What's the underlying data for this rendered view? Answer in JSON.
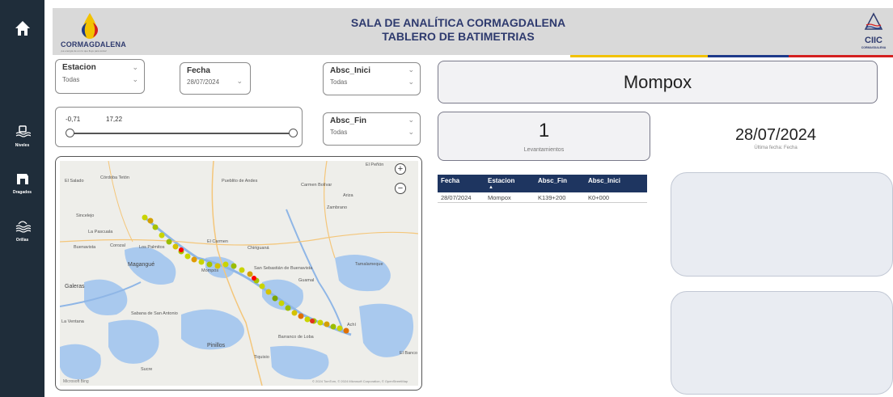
{
  "header": {
    "title_line1": "SALA DE ANALÍTICA CORMAGDALENA",
    "title_line2": "TABLERO DE BATIMETRIAS",
    "logo_left_text": "CORMAGDALENA",
    "logo_left_tagline": "¡La energía de un río que fluye para todos!",
    "logo_right_text": "CIIC",
    "logo_right_sub": "CORMAGDALENA"
  },
  "sidebar": {
    "items": [
      {
        "label": "",
        "icon": "home-icon"
      },
      {
        "label": "Niveles",
        "icon": "gauge-icon"
      },
      {
        "label": "Dragados",
        "icon": "dredge-icon"
      },
      {
        "label": "Orillas",
        "icon": "waves-icon"
      }
    ]
  },
  "filters": {
    "estacion": {
      "title": "Estacion",
      "value": "Todas"
    },
    "fecha": {
      "title": "Fecha",
      "value": "28/07/2024"
    },
    "absc_inici": {
      "title": "Absc_Inici",
      "value": "Todas"
    },
    "absc_fin": {
      "title": "Absc_Fin",
      "value": "Todas"
    },
    "range": {
      "min_label": "-0,71",
      "max_label": "17,22"
    }
  },
  "station_card": {
    "value": "Mompox"
  },
  "count_card": {
    "value": "1",
    "label": "Levantamientos"
  },
  "date_card": {
    "value": "28/07/2024",
    "label": "Última fecha: Fecha"
  },
  "table": {
    "headers": [
      "Fecha",
      "Estacion",
      "Absc_Fin",
      "Absc_Inici"
    ],
    "rows": [
      [
        "28/07/2024",
        "Mompox",
        "K139+200",
        "K0+000"
      ]
    ]
  },
  "map": {
    "labels": [
      "El Salado",
      "Córdoba Tetón",
      "Pueblito de Andes",
      "Carmen Bolívar",
      "Zambrano",
      "Ariza",
      "Sincelejo",
      "La Pascuala",
      "Corozal",
      "Los Palmitos",
      "El Carmen",
      "Chiriguaná",
      "Tamalameque",
      "Magangué",
      "Mompós",
      "Galeras",
      "San Sebastián de Buenavista",
      "Guamal",
      "Sucre",
      "Pinillos",
      "Tiquisio",
      "Barranco de Loba",
      "El Banco",
      "Achí",
      "La Ventana",
      "Sabana de San Antonio",
      "Buenavista",
      "El Peñón"
    ],
    "attribution": "© 2024 TomTom, © 2024 Microsoft Corporation, © OpenStreetMap",
    "logo": "Microsoft Bing"
  },
  "colors": {
    "sidebar": "#1f2d3a",
    "header": "#d9d9d9",
    "title": "#2e3a6e",
    "table_header": "#1e3560",
    "stripe_yellow": "#f2c200",
    "stripe_blue": "#1e3a8a",
    "stripe_red": "#d42020"
  }
}
